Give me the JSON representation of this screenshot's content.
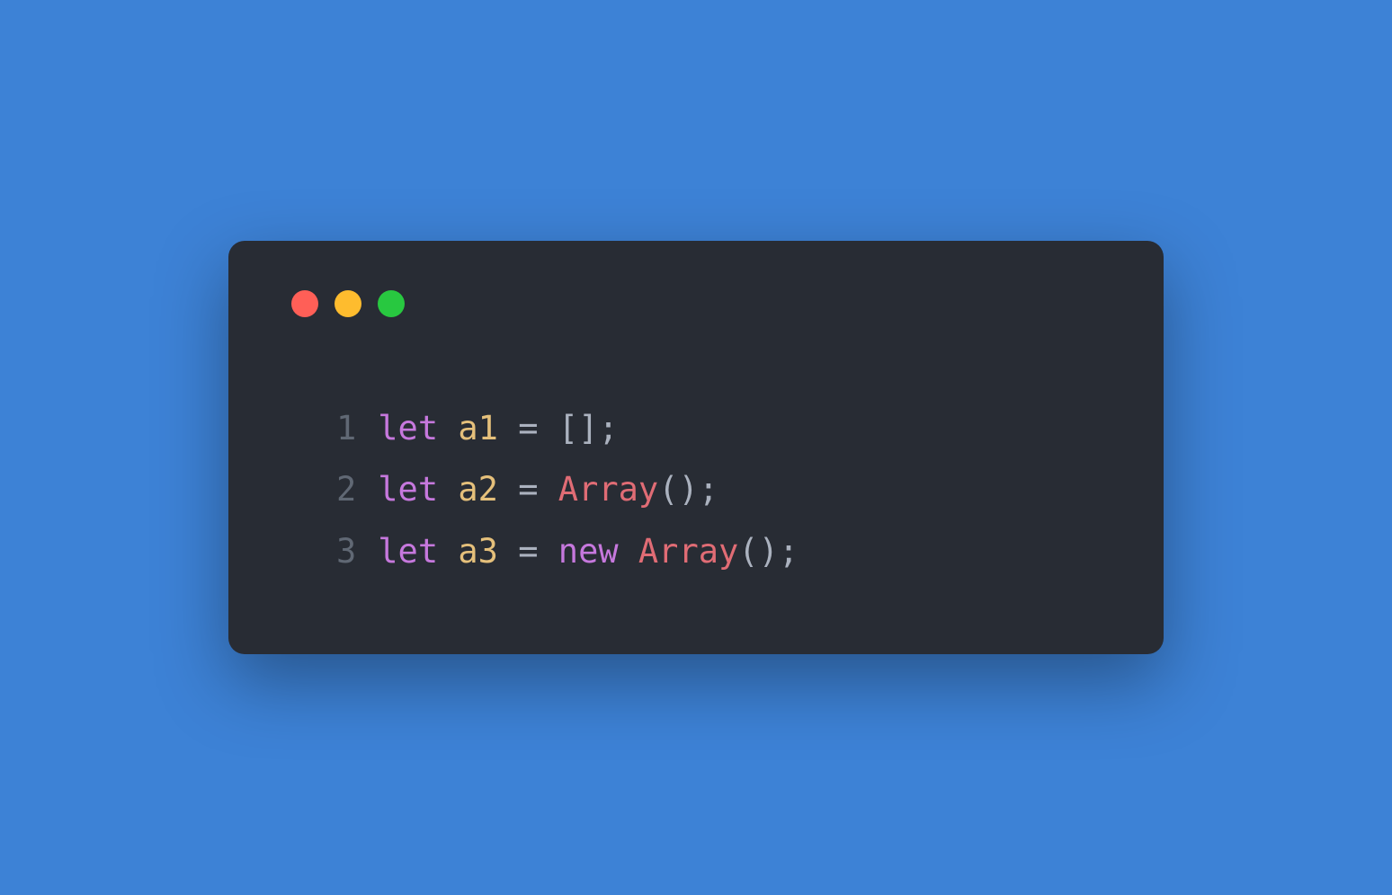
{
  "colors": {
    "background": "#3d82d6",
    "editor_bg": "#282c34",
    "red": "#ff5f57",
    "yellow": "#febc2e",
    "green": "#28c840",
    "keyword": "#c678dd",
    "identifier": "#e5c07b",
    "operator": "#abb2bf",
    "punctuation": "#abb2bf",
    "class": "#e06c75",
    "line_number": "#606874"
  },
  "code": {
    "lines": [
      {
        "number": "1",
        "tokens": [
          {
            "text": "let",
            "type": "keyword"
          },
          {
            "text": " ",
            "type": "default"
          },
          {
            "text": "a1",
            "type": "identifier"
          },
          {
            "text": " ",
            "type": "default"
          },
          {
            "text": "=",
            "type": "operator"
          },
          {
            "text": " ",
            "type": "default"
          },
          {
            "text": "[];",
            "type": "punctuation"
          }
        ]
      },
      {
        "number": "2",
        "tokens": [
          {
            "text": "let",
            "type": "keyword"
          },
          {
            "text": " ",
            "type": "default"
          },
          {
            "text": "a2",
            "type": "identifier"
          },
          {
            "text": " ",
            "type": "default"
          },
          {
            "text": "=",
            "type": "operator"
          },
          {
            "text": " ",
            "type": "default"
          },
          {
            "text": "Array",
            "type": "class"
          },
          {
            "text": "();",
            "type": "punctuation"
          }
        ]
      },
      {
        "number": "3",
        "tokens": [
          {
            "text": "let",
            "type": "keyword"
          },
          {
            "text": " ",
            "type": "default"
          },
          {
            "text": "a3",
            "type": "identifier"
          },
          {
            "text": " ",
            "type": "default"
          },
          {
            "text": "=",
            "type": "operator"
          },
          {
            "text": " ",
            "type": "default"
          },
          {
            "text": "new",
            "type": "keyword"
          },
          {
            "text": " ",
            "type": "default"
          },
          {
            "text": "Array",
            "type": "class"
          },
          {
            "text": "();",
            "type": "punctuation"
          }
        ]
      }
    ]
  }
}
